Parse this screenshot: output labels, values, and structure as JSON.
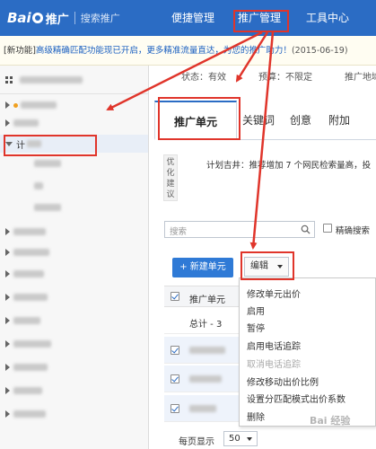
{
  "brand": {
    "logo_text": "Bai",
    "logo_text2": "推广",
    "subtitle": "搜索推广"
  },
  "topnav": {
    "items": [
      "便捷管理",
      "推广管理",
      "工具中心"
    ]
  },
  "notice": {
    "tag": "[新功能]",
    "text": "高级精确匹配功能现已开启，更多精准流量直达，为您的推广助力！",
    "date": "(2015-06-19)"
  },
  "status": {
    "state": "状态：有效",
    "budget": "预算：不限定",
    "region": "推广地域：北京"
  },
  "tabs": [
    "推广单元",
    "关键词",
    "创意",
    "附加"
  ],
  "optimize": {
    "side_label": "优化建议",
    "text": "计划吉井：推荐增加 7 个网民检索量高，投"
  },
  "search": {
    "placeholder": "搜索",
    "exact_label": "精确搜索"
  },
  "toolbar": {
    "new_unit": "+ 新建单元",
    "edit": "编辑"
  },
  "table": {
    "header": "推广单元",
    "total": "总计 - 3"
  },
  "edit_menu": [
    {
      "label": "修改单元出价",
      "disabled": false
    },
    {
      "label": "启用",
      "disabled": false
    },
    {
      "label": "暂停",
      "disabled": false
    },
    {
      "label": "启用电话追踪",
      "disabled": false
    },
    {
      "label": "取消电话追踪",
      "disabled": true
    },
    {
      "label": "修改移动出价比例",
      "disabled": false
    },
    {
      "label": "设置分匹配模式出价系数",
      "disabled": false
    },
    {
      "label": "删除",
      "disabled": false
    }
  ],
  "pager": {
    "label": "每页显示",
    "value": "50"
  },
  "watermark": "Bai 经验",
  "colors": {
    "topbar": "#2b6cc4",
    "annotation": "#e0352b",
    "primary_button": "#2f7ad6"
  }
}
